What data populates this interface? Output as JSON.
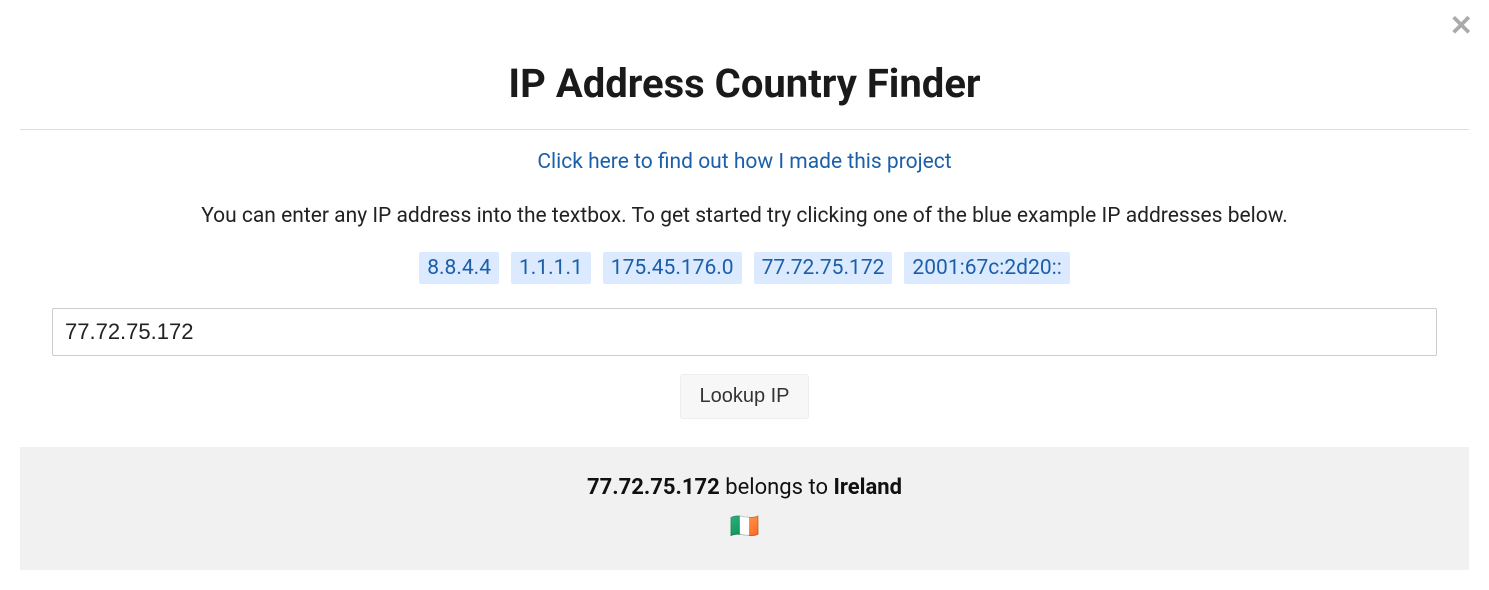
{
  "header": {
    "title": "IP Address Country Finder"
  },
  "link": {
    "text": "Click here to find out how I made this project"
  },
  "instructions": "You can enter any IP address into the textbox. To get started try clicking one of the blue example IP addresses below.",
  "examples": [
    "8.8.4.4",
    "1.1.1.1",
    "175.45.176.0",
    "77.72.75.172",
    "2001:67c:2d20::"
  ],
  "input": {
    "value": "77.72.75.172"
  },
  "lookup": {
    "label": "Lookup IP"
  },
  "result": {
    "ip": "77.72.75.172",
    "middle": " belongs to ",
    "country": "Ireland",
    "flag": "🇮🇪"
  }
}
